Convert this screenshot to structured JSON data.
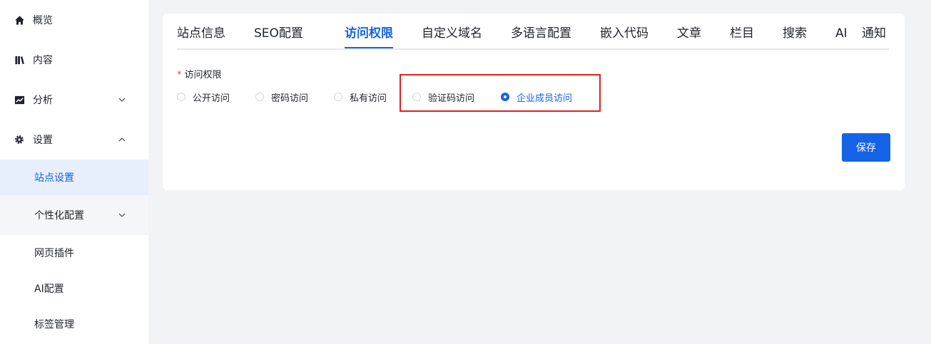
{
  "sidebar": {
    "items": [
      {
        "label": "概览",
        "icon": "home-icon"
      },
      {
        "label": "内容",
        "icon": "book-icon"
      },
      {
        "label": "分析",
        "icon": "chart-icon"
      },
      {
        "label": "设置",
        "icon": "gear-icon"
      }
    ],
    "sub_items": [
      {
        "label": "站点设置",
        "active": true
      },
      {
        "label": "个性化配置"
      },
      {
        "label": "网页插件"
      },
      {
        "label": "AI配置"
      },
      {
        "label": "标签管理"
      }
    ]
  },
  "tabs": [
    {
      "label": "站点信息"
    },
    {
      "label": "SEO配置"
    },
    {
      "label": "访问权限",
      "active": true
    },
    {
      "label": "自定义域名"
    },
    {
      "label": "多语言配置"
    },
    {
      "label": "嵌入代码"
    },
    {
      "label": "文章"
    },
    {
      "label": "栏目"
    },
    {
      "label": "搜索"
    },
    {
      "label": "AI"
    },
    {
      "label": "通知"
    }
  ],
  "form": {
    "required_mark": "*",
    "label": "访问权限",
    "options": [
      {
        "label": "公开访问"
      },
      {
        "label": "密码访问"
      },
      {
        "label": "私有访问"
      },
      {
        "label": "验证码访问"
      },
      {
        "label": "企业成员访问",
        "checked": true
      }
    ],
    "save_label": "保存"
  },
  "colors": {
    "accent": "#1463e6",
    "highlight": "#e02020",
    "background": "#f2f3f7"
  }
}
